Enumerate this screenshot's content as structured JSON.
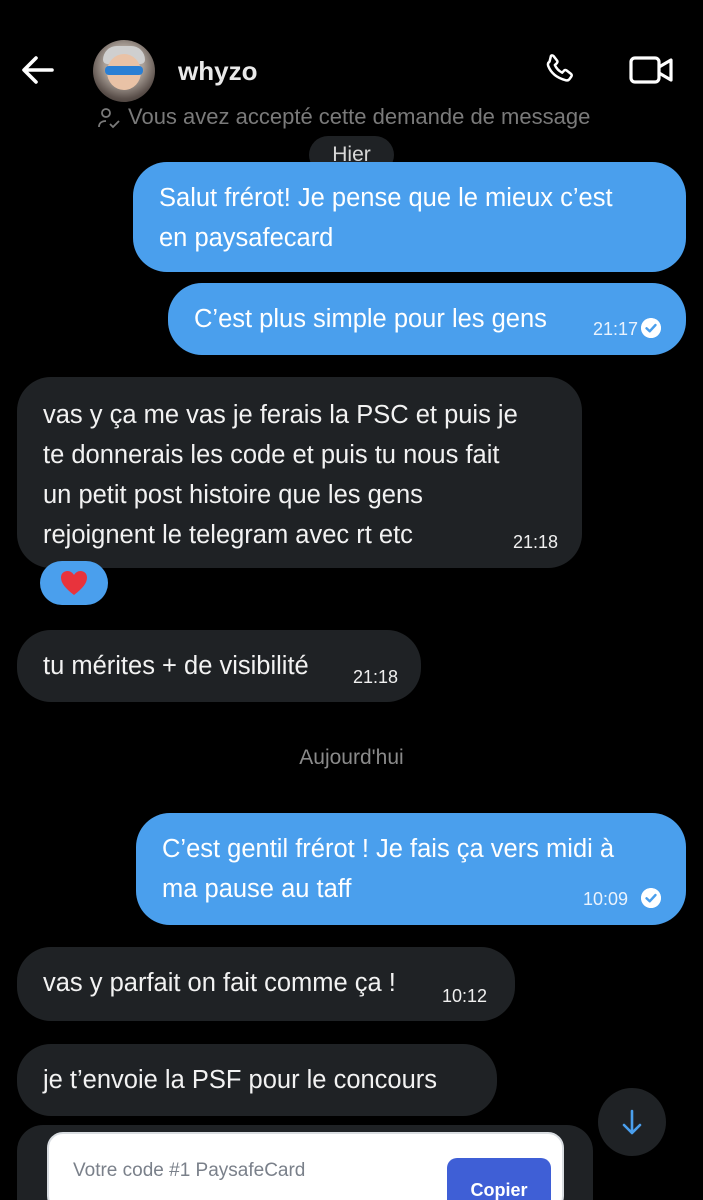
{
  "header": {
    "username": "whyzo",
    "icons": {
      "back": "arrow-left-icon",
      "call": "phone-icon",
      "video": "video-camera-icon"
    }
  },
  "notice": {
    "text": "Vous avez accepté cette demande de message"
  },
  "dividers": {
    "yesterday": "Hier",
    "today": "Aujourd'hui"
  },
  "messages": [
    {
      "dir": "out",
      "text_lines": [
        "Salut frérot! Je pense que le mieux c’est",
        "en paysafecard"
      ]
    },
    {
      "dir": "out",
      "text": "C’est plus simple pour les gens",
      "time": "21:17",
      "read": true
    },
    {
      "dir": "in",
      "text_lines": [
        "vas y ça me vas je ferais la PSC et puis je",
        "te donnerais les code et puis tu nous fait",
        "un petit post histoire que les gens",
        "rejoignent le telegram avec rt etc"
      ],
      "time": "21:18",
      "reaction": "❤️"
    },
    {
      "dir": "in",
      "text": "tu mérites + de visibilité",
      "time": "21:18"
    },
    {
      "dir": "out",
      "text_lines": [
        "C’est gentil frérot ! Je fais ça vers midi à",
        "ma pause au taff"
      ],
      "time": "10:09",
      "read": true
    },
    {
      "dir": "in",
      "text": "vas y parfait on fait comme ça !",
      "time": "10:12"
    },
    {
      "dir": "in",
      "text": "je t’envoie la PSF pour le concours"
    }
  ],
  "card": {
    "label": "Votre code #1 PaysafeCard",
    "button": "Copier"
  },
  "colors": {
    "outgoing": "#4a9fed",
    "incoming": "#1f2225",
    "background": "#000000",
    "button": "#3f5fd6"
  }
}
